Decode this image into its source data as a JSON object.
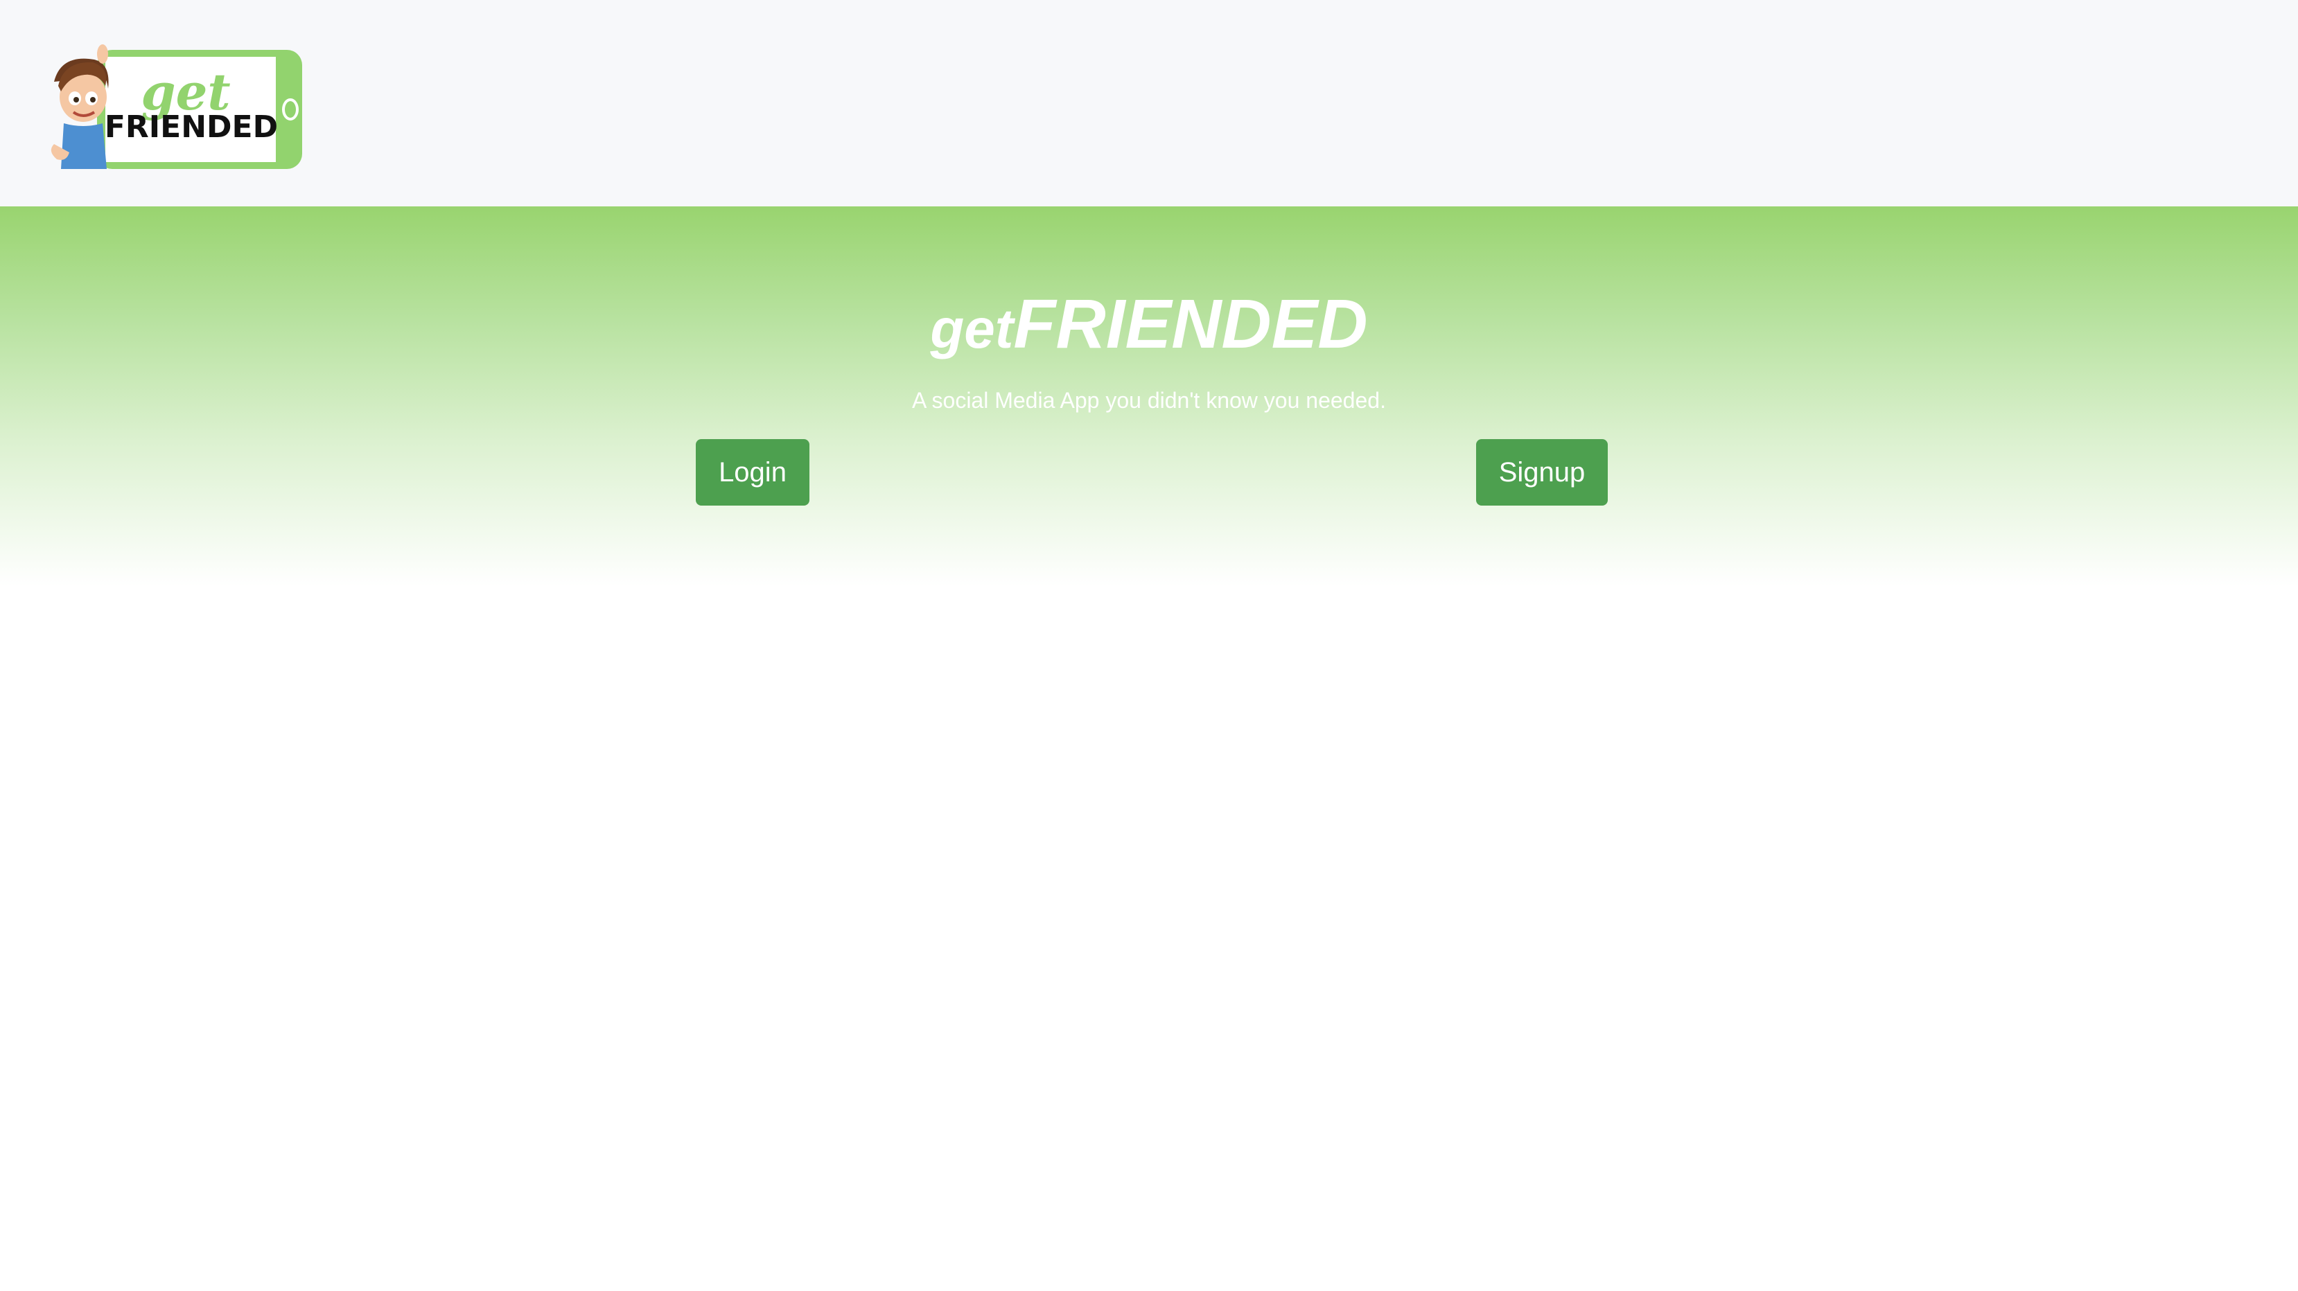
{
  "brand": {
    "logo_word_small": "get",
    "logo_word_big": "FRIENDED",
    "green": "#92d36e",
    "logo_icon": "cartoon-boy-holding-phone"
  },
  "hero": {
    "title_small": "get",
    "title_big": "FRIENDED",
    "subtitle": "A social Media App you didn't know you needed.",
    "gradient_top": "#99d46f",
    "gradient_bottom": "#ffffff"
  },
  "buttons": {
    "login_label": "Login",
    "signup_label": "Signup",
    "color": "#4da04f"
  }
}
